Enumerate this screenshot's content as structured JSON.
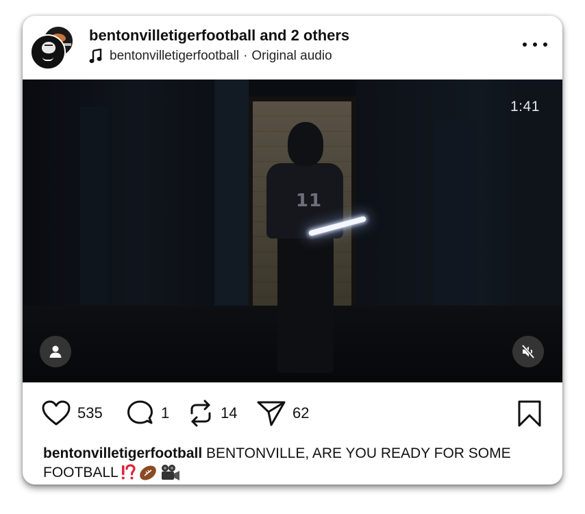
{
  "post": {
    "header": {
      "username": "bentonvilletigerfootball",
      "collaborators": "and 2 others",
      "audio_username": "bentonvilletigerfootball",
      "audio_separator": "·",
      "audio_label": "Original audio"
    },
    "video": {
      "duration": "1:41",
      "jersey_text": "11",
      "muted": true
    },
    "actions": {
      "likes": "535",
      "comments": "1",
      "reposts": "14",
      "shares": "62"
    },
    "caption": {
      "username": "bentonvilletigerfootball",
      "text": "BENTONVILLE, ARE YOU READY FOR SOME FOOTBALL"
    }
  },
  "icons": {
    "more": "more-horizontal-icon",
    "music": "music-note-icon",
    "like": "heart-icon",
    "comment": "comment-bubble-icon",
    "repost": "repost-icon",
    "share": "paper-plane-icon",
    "save": "bookmark-icon",
    "tag": "person-icon",
    "mute": "speaker-muted-icon"
  },
  "colors": {
    "text": "#111111",
    "video_bg": "#0a0d12",
    "emoji_red": "#e0223a"
  }
}
